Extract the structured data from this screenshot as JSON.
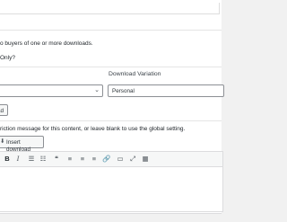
{
  "form": {
    "description": "o buyers of one or more downloads.",
    "only_label": "Only?",
    "column_header_variation": "Download Variation",
    "variation_value": "Personal",
    "add_button_label": "ad",
    "restriction_message": "riction message for this content, or leave blank to use the global setting.",
    "insert_download_label": "Insert download"
  },
  "editor_toolbar": {
    "buttons": [
      {
        "name": "bold-button",
        "glyph": "B"
      },
      {
        "name": "italic-button",
        "glyph": "I"
      },
      {
        "name": "bulleted-list-button",
        "glyph": "☰"
      },
      {
        "name": "numbered-list-button",
        "glyph": "☷"
      },
      {
        "name": "blockquote-button",
        "glyph": "❝"
      },
      {
        "name": "align-left-button",
        "glyph": "≡"
      },
      {
        "name": "align-center-button",
        "glyph": "≡"
      },
      {
        "name": "align-right-button",
        "glyph": "≡"
      },
      {
        "name": "insert-link-button",
        "glyph": "🔗"
      },
      {
        "name": "more-tag-button",
        "glyph": "▭"
      },
      {
        "name": "fullscreen-button",
        "glyph": "⤢"
      },
      {
        "name": "toolbar-toggle-button",
        "glyph": "▦"
      }
    ]
  },
  "icons": {
    "select_chevron": "chevron-down-icon",
    "insert_download_icon": "download-icon"
  },
  "colors": {
    "border": "#8c8f94",
    "button_bg": "#f6f7f7",
    "text": "#23282d"
  }
}
